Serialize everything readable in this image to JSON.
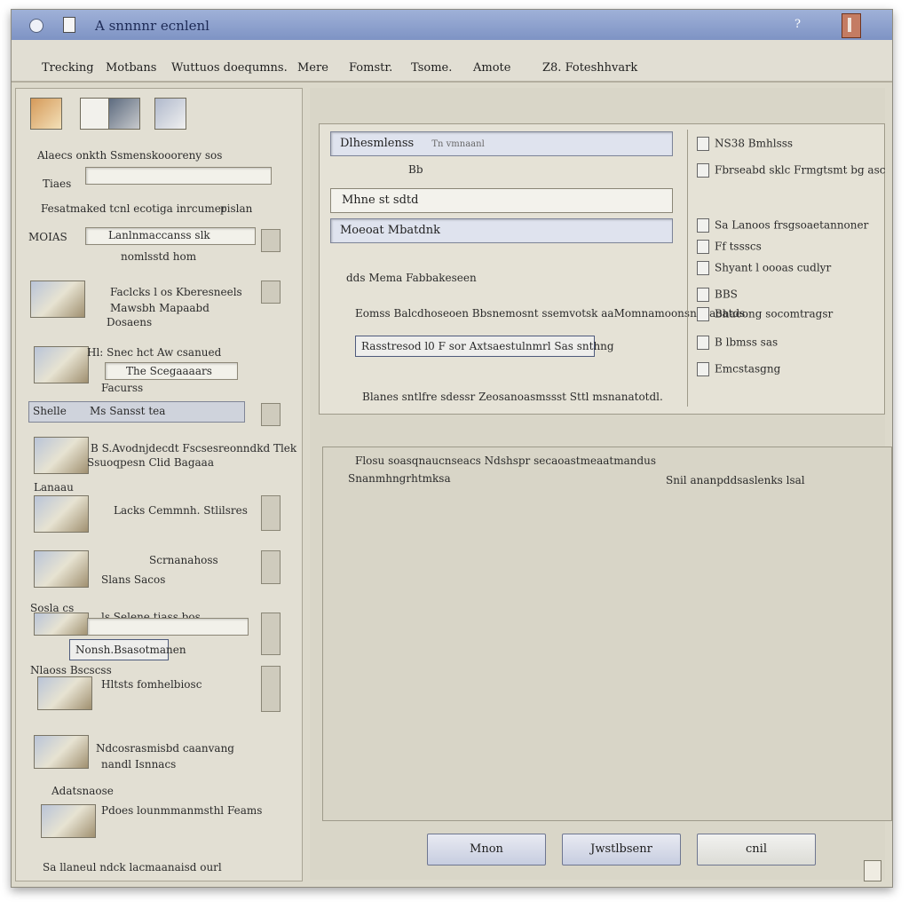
{
  "window": {
    "title": "A snnnnr ecnlenl",
    "help_label": "?"
  },
  "menubar": {
    "items": [
      "Trecking",
      "Motbans",
      "Wuttuos doequmns.",
      "Mere",
      "Fomstr.",
      "Tsome.",
      "Amote",
      "Z8. Foteshhvark"
    ]
  },
  "sidebar": {
    "section1_label": "Alaecs onkth  Ssmenskoooreny sos",
    "section2_label": "Tiaes",
    "section3_label": "Fesatmaked tcnl ecotiga inrcumer",
    "section3_aside": "pislan",
    "row1_left": "MOIAS",
    "row1_text": "Lanlnmaccanss slk",
    "row1_sub": "nomlsstd hom",
    "row2_title": "Faclcks l os Kberesneels",
    "row2_sub1": "Mawsbh Mapaabd",
    "row2_sub2": "Dosaens",
    "row3_title": "Hl: Snec hct Aw csanued",
    "row3_sub": "The Scegaaaars",
    "row3_sub2": "Facurss",
    "selected_left": "Shelle",
    "selected_text": "Ms  Sansst tea",
    "row4_title": "B S.Avodnjdecdt Fscsesreonndkd Tlek",
    "row4_sub": "Ssuoqpesn Clid Bagaaa",
    "row5_label": "Lanaau",
    "row5_title": "Lacks Cemmnh. Stlilsres",
    "row6_title": "Scrnanahoss",
    "row6_sub": "Slans Sacos",
    "row7_label": "Sosla cs",
    "row7_text": "ls Selene  tiass bos",
    "highlight_text": "Nonsh.Bsasotmanen",
    "row8_label": "Nlaoss Bscscss",
    "row8_text": "Hltsts fomhelbiosc",
    "row9_text": "Ndcosrasmisbd caanvang",
    "row9_sub": "nandl  Isnnacs",
    "row10_text": "Adatsnaose",
    "row10_sub": "Pdoes lounmmanmsthl Feams",
    "footer_text": "Sa  llaneul  ndck  lacmaanaisd ourl"
  },
  "main": {
    "field1_value": "Dlhesmlenss",
    "field1_hint": "Tn  vmnaanl",
    "label_row": "Bb",
    "field2_value": "Mhne st sdtd",
    "field3_value": "Moeoat Mbatdnk",
    "desc1": "dds  Mema  Fabbakeseen",
    "desc2": "Eomss Balcdhoseoen Bbsnemosnt  ssemvotsk aaMomnamoonsneoaoatds.",
    "link_text": "Rasstresod l0 F sor  Axtsaestulnmrl Sas snthng",
    "footer_text": "Blanes  sntlfre  sdessr  Zeosanoasmssst  Sttl  msnanatotdl.",
    "rightcol": [
      "NS38  Bmhlsss",
      "Fbrseabd  sklc  Frmgtsmt bg  asc",
      "Sa Lanoos  frsgsoaetannoner",
      "Ff  tssscs",
      "Shyant  l  oooas  cudlyr",
      "BBS",
      "Bhaeong  socomtragsr",
      "B lbmss sas",
      "Emcstasgng"
    ],
    "bottom_line1": "Flosu  soasqnaucnseacs  Ndshspr  secaoastmeaatmandus",
    "bottom_line2": "Snanmhngrhtmksa",
    "bottom_right": "Snil  ananpddsaslenks  lsal"
  },
  "buttons": {
    "left": "Mnon",
    "middle": "Jwstlbsenr",
    "right": "cnil"
  },
  "colors": {
    "title_bar": "#8ea2d0",
    "window_bg": "#dcd9cb",
    "field_blue": "#dfe3ee"
  }
}
